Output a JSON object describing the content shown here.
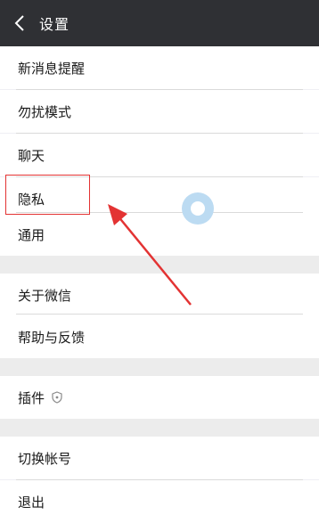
{
  "header": {
    "title": "设置",
    "back_icon": "chevron-left-icon"
  },
  "menu": {
    "group1": [
      "新消息提醒",
      "勿扰模式",
      "聊天",
      "隐私",
      "通用"
    ],
    "group2": [
      "关于微信",
      "帮助与反馈"
    ],
    "group3": {
      "label": "插件",
      "icon": "shield-icon"
    },
    "group4": [
      "切换帐号",
      "退出"
    ]
  },
  "colors": {
    "header_bg": "#2f3034",
    "page_bg": "#efeff4",
    "highlight": "#e33333",
    "ring": "#bcdbf2"
  }
}
